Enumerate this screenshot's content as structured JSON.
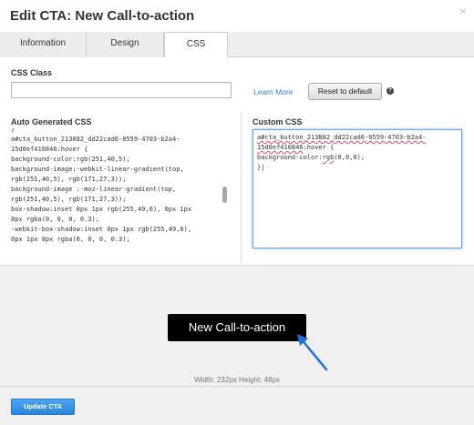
{
  "dialog": {
    "title": "Edit CTA: New Call-to-action",
    "close_glyph": "×"
  },
  "tabs": [
    {
      "label": "Information"
    },
    {
      "label": "Design"
    },
    {
      "label": "CSS",
      "active": true
    }
  ],
  "css_class": {
    "label": "CSS Class",
    "value": "",
    "learn_more": "Learn More",
    "reset_label": "Reset to default",
    "help_glyph": "?"
  },
  "auto_css": {
    "label": "Auto Generated CSS",
    "code": "}\na#cta_button_213882_dd22cad6-0559-4703-b2a4-\n15d0ef410846:hover {\nbackground-color:rgb(251,40,5);\nbackground-image:-webkit-linear-gradient(top,\nrgb(251,40,5), rgb(171,27,3));\nbackground-image :-moz-linear-gradient(top,\nrgb(251,40,5), rgb(171,27,3));\nbox-shadow:inset 0px 1px rgb(255,49,6), 0px 1px\n8px rgba(0, 0, 0, 0.3);\n-webkit-box-shadow:inset 0px 1px rgb(255,49,6),\n0px 1px 8px rgba(0, 0, 0, 0.3);"
  },
  "custom_css": {
    "label": "Custom CSS",
    "line1": "a#cta_button_213882_dd22cad6-0559-4703-b2a4-",
    "line2": "15d0ef410846",
    "line2_rest": ":hover {",
    "line3_pre": "background-color:",
    "line3_mid": "rgb",
    "line3_post": "(0,0,0);",
    "line4": "}"
  },
  "preview": {
    "cta_text": "New Call-to-action",
    "dimensions": "Width: 232px   Height: 48px"
  },
  "footer": {
    "update_label": "Update CTA"
  },
  "colors": {
    "link": "#3a7cc9",
    "primary_button": "#2a86db",
    "cta_background": "#000000",
    "arrow": "#1e6fd9"
  }
}
